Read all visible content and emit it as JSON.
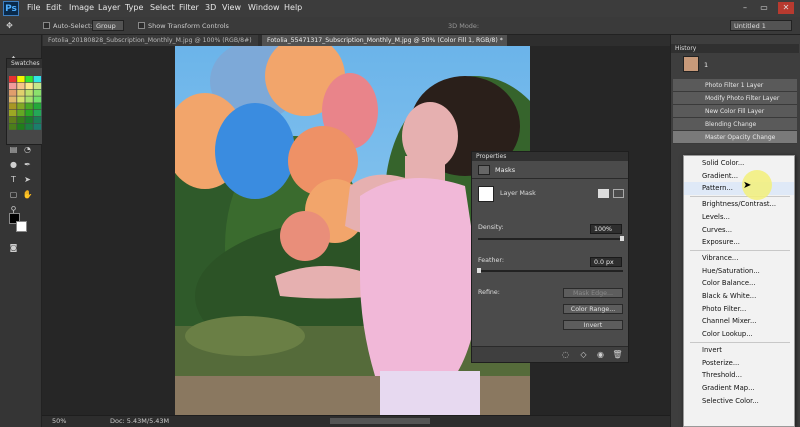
{
  "menubar": {
    "logo": "Ps",
    "items": [
      "File",
      "Edit",
      "Image",
      "Layer",
      "Type",
      "Select",
      "Filter",
      "3D",
      "View",
      "Window",
      "Help"
    ],
    "window_buttons": [
      "–",
      "▭",
      "✕"
    ]
  },
  "options": {
    "auto_select": "Auto-Select:",
    "auto_select_value": "Group",
    "show_transform": "Show Transform Controls",
    "mode_3d": "3D Mode:",
    "workspace": "Untitled 1"
  },
  "tabs": [
    {
      "label": "Fotolia_20180828_Subscription_Monthly_M.jpg @ 100% (RGB/8#)",
      "close": "×"
    },
    {
      "label": "Fotolia_55471317_Subscription_Monthly_M.jpg @ 50% (Color Fill 1, RGB/8) *",
      "close": "×"
    }
  ],
  "swatches": {
    "title": "Swatches"
  },
  "history": {
    "title": "History",
    "snapshot": "1",
    "items": [
      "Photo Filter 1 Layer",
      "Modify Photo Filter Layer",
      "New Color Fill Layer",
      "Blending Change",
      "Master Opacity Change"
    ]
  },
  "properties": {
    "title": "Properties",
    "section": "Masks",
    "layer_mask": "Layer Mask",
    "density_label": "Density:",
    "density_value": "100%",
    "density": 100,
    "feather_label": "Feather:",
    "feather_value": "0.0 px",
    "feather": 0,
    "refine_label": "Refine:",
    "buttons": [
      "Mask Edge...",
      "Color Range...",
      "Invert"
    ]
  },
  "adjust_menu": {
    "items": [
      "Solid Color...",
      "Gradient...",
      "Pattern...",
      "Brightness/Contrast...",
      "Levels...",
      "Curves...",
      "Exposure...",
      "Vibrance...",
      "Hue/Saturation...",
      "Color Balance...",
      "Black & White...",
      "Photo Filter...",
      "Channel Mixer...",
      "Color Lookup...",
      "Invert",
      "Posterize...",
      "Threshold...",
      "Gradient Map...",
      "Selective Color..."
    ],
    "highlighted": "Pattern..."
  },
  "status": {
    "zoom": "50%",
    "doc": "Doc: 5.43M/5.43M"
  },
  "colors": {
    "accent": "#3d7ec0",
    "highlight": "#f3f07a",
    "pink_top": "#f1b8d8"
  }
}
